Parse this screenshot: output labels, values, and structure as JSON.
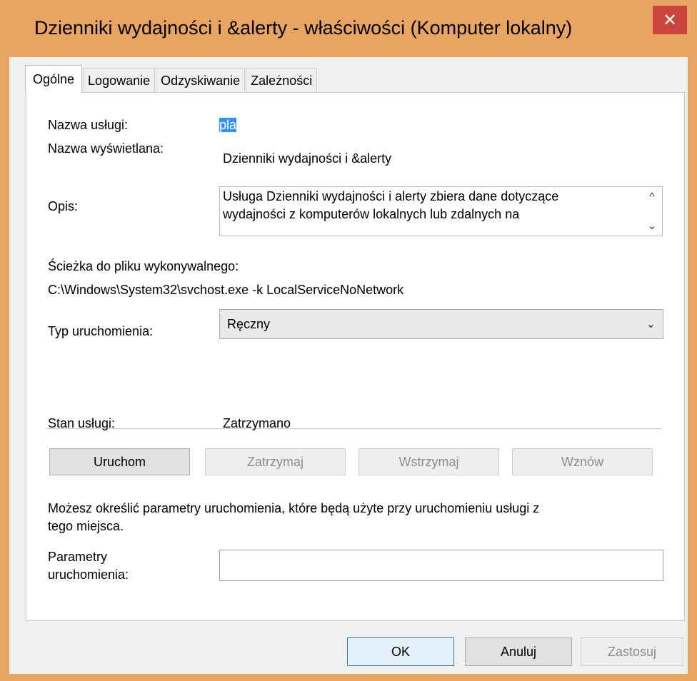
{
  "window": {
    "title": "Dzienniki wydajności i &alerty - właściwości (Komputer lokalny)",
    "close_glyph": "✕"
  },
  "tabs": [
    {
      "label": "Ogólne",
      "active": true
    },
    {
      "label": "Logowanie",
      "active": false
    },
    {
      "label": "Odzyskiwanie",
      "active": false
    },
    {
      "label": "Zależności",
      "active": false
    }
  ],
  "general": {
    "service_name_label": "Nazwa usługi:",
    "service_name_value": "pla",
    "display_name_label": "Nazwa wyświetlana:",
    "display_name_value": "Dzienniki wydajności i &alerty",
    "description_label": "Opis:",
    "description_line1": "Usługa Dzienniki wydajności i alerty zbiera dane dotyczące",
    "description_line2": "wydajności z komputerów lokalnych lub zdalnych na",
    "path_label": "Ścieżka do pliku wykonywalnego:",
    "path_value": "C:\\Windows\\System32\\svchost.exe -k LocalServiceNoNetwork",
    "startup_type_label": "Typ uruchomienia:",
    "startup_type_value": "Ręczny",
    "status_label": "Stan usługi:",
    "status_value": "Zatrzymano",
    "buttons": {
      "start": "Uruchom",
      "stop": "Zatrzymaj",
      "pause": "Wstrzymaj",
      "resume": "Wznów"
    },
    "params_info_line1": "Możesz określić parametry uruchomienia, które będą użyte przy uruchomieniu usługi z",
    "params_info_line2": "tego miejsca.",
    "params_label_line1": "Parametry",
    "params_label_line2": "uruchomienia:",
    "params_value": ""
  },
  "footer": {
    "ok": "OK",
    "cancel": "Anuluj",
    "apply": "Zastosuj"
  },
  "icons": {
    "scroll_up": "^",
    "scroll_down": "⌄",
    "dropdown": "⌄"
  },
  "colors": {
    "frame": "#e8a462",
    "close": "#c9453c",
    "selection": "#3390ff"
  }
}
